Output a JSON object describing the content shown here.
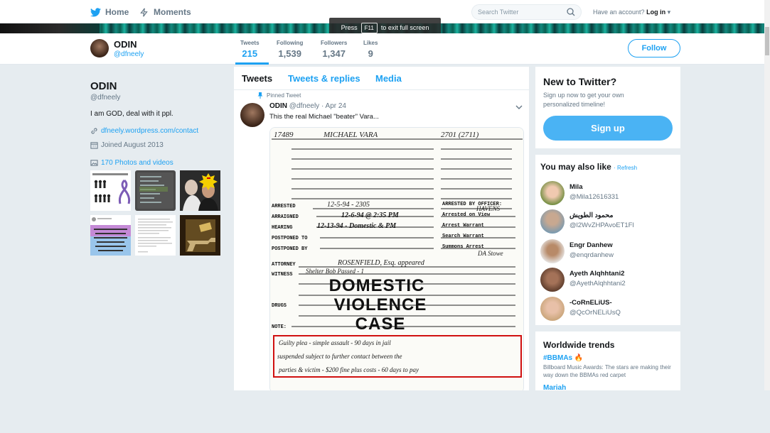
{
  "nav": {
    "home_label": "Home",
    "moments_label": "Moments",
    "search_placeholder": "Search Twitter",
    "account_prompt": "Have an account?",
    "login_label": "Log in"
  },
  "fullscreen_toast": {
    "prefix": "Press",
    "key": "F11",
    "suffix": "to exit full screen"
  },
  "profile": {
    "name": "ODIN",
    "handle": "@dfneely",
    "bio": "I am GOD, deal with it ppl.",
    "link": "dfneely.wordpress.com/contact",
    "joined": "Joined August 2013",
    "photos": "170 Photos and videos"
  },
  "stats": [
    {
      "label": "Tweets",
      "value": "215"
    },
    {
      "label": "Following",
      "value": "1,539"
    },
    {
      "label": "Followers",
      "value": "1,347"
    },
    {
      "label": "Likes",
      "value": "9"
    }
  ],
  "follow_label": "Follow",
  "timeline_tabs": [
    "Tweets",
    "Tweets & replies",
    "Media"
  ],
  "tweet": {
    "pinned_label": "Pinned Tweet",
    "name": "ODIN",
    "handle": "@dfneely",
    "date": "· Apr 24",
    "text": "This the real Michael \"beater\" Vara..."
  },
  "document": {
    "case_no": "17489",
    "defendant": "MICHAEL VARA",
    "code": "2701 (2711)",
    "arrested": "12-5-94 - 2305",
    "arraigned": "12-6-94 @ 2:35 PM",
    "hearing": "12-13-94 - Domestic & PM",
    "officer_label": "ARRESTED BY OFFICER:",
    "officer": "HAVENS",
    "attorney": "ROSENFIELD, Esq. appeared",
    "witness": "Shelter Bob Passed - 1",
    "stamp_lines": [
      "DOMESTIC",
      "VIOLENCE",
      "CASE"
    ],
    "labels": [
      "ARRESTED",
      "ARRAIGNED",
      "HEARING",
      "POSTPONED TO",
      "POSTPONED BY",
      "ATTORNEY",
      "WITNESS",
      "DRUGS",
      "NOTE:"
    ],
    "right_labels": [
      "Arrested on View",
      "Arrest Warrant",
      "Search Warrant",
      "Summons Arrest"
    ],
    "note_lines": [
      "Guilty plea - simple assault - 90 days in jail",
      "suspended subject to further contact between the",
      "parties & victim - $200 fine plus costs - 60 days to pay"
    ],
    "da_note": "DA Stowe"
  },
  "new_to_twitter": {
    "title": "New to Twitter?",
    "subtitle": "Sign up now to get your own personalized timeline!",
    "button": "Sign up"
  },
  "you_may_like": {
    "title": "You may also like",
    "refresh": "· Refresh",
    "users": [
      {
        "name": "Mila",
        "handle": "@Mila12616331"
      },
      {
        "name": "محمود الطويش",
        "handle": "@l2WvZHPAvoET1Fl"
      },
      {
        "name": "Engr Danhew",
        "handle": "@enqrdanhew"
      },
      {
        "name": "Ayeth Alqhhtani2",
        "handle": "@AyethAlqhhtani2"
      },
      {
        "name": "-CoRnELiUS-",
        "handle": "@QcOrNELiUsQ"
      }
    ]
  },
  "trends": {
    "title": "Worldwide trends",
    "items": [
      {
        "tag": "#BBMAs",
        "desc": "Billboard Music Awards: The stars are making their way down the BBMAs red carpet"
      },
      {
        "tag": "Mariah",
        "desc": ""
      }
    ]
  },
  "colors": {
    "accent": "#1da1f2",
    "signup": "#4ab3f4",
    "background": "#e6ecf0"
  }
}
